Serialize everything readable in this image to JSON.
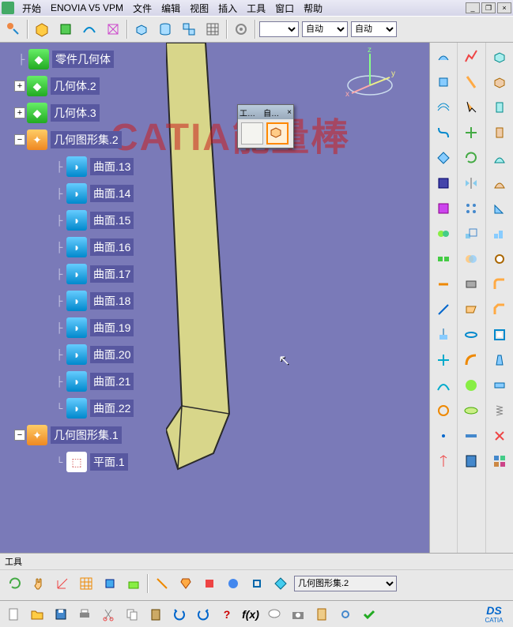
{
  "menu": {
    "start": "开始",
    "enovia": "ENOVIA V5 VPM",
    "file": "文件",
    "edit": "编辑",
    "view": "视图",
    "insert": "插入",
    "tools": "工具",
    "window": "窗口",
    "help": "帮助"
  },
  "toolbar1": {
    "combo_empty": "",
    "combo_auto1": "自动",
    "combo_auto2": "自动"
  },
  "tree": {
    "root_partial": "…",
    "part_body": "零件几何体",
    "body2": "几何体.2",
    "body3": "几何体.3",
    "gset2": "几何图形集.2",
    "surfaces": [
      "曲面.13",
      "曲面.14",
      "曲面.15",
      "曲面.16",
      "曲面.17",
      "曲面.18",
      "曲面.19",
      "曲面.20",
      "曲面.21",
      "曲面.22"
    ],
    "gset1": "几何图形集.1",
    "plane1": "平面.1"
  },
  "watermark": "CATIA能量棒",
  "compass": {
    "x": "x",
    "y": "y",
    "z": "z"
  },
  "float_toolbar": {
    "title_prefix": "工…",
    "title": "自…",
    "close": "×"
  },
  "bottom": {
    "panel_title": "工具",
    "current_object": "几何图形集.2"
  },
  "ds_logo": {
    "top": "DS",
    "bottom": "CATIA"
  },
  "colors": {
    "viewport": "#7a7ab8",
    "part_fill": "#d8d68a",
    "part_edge": "#2a2a2a"
  }
}
